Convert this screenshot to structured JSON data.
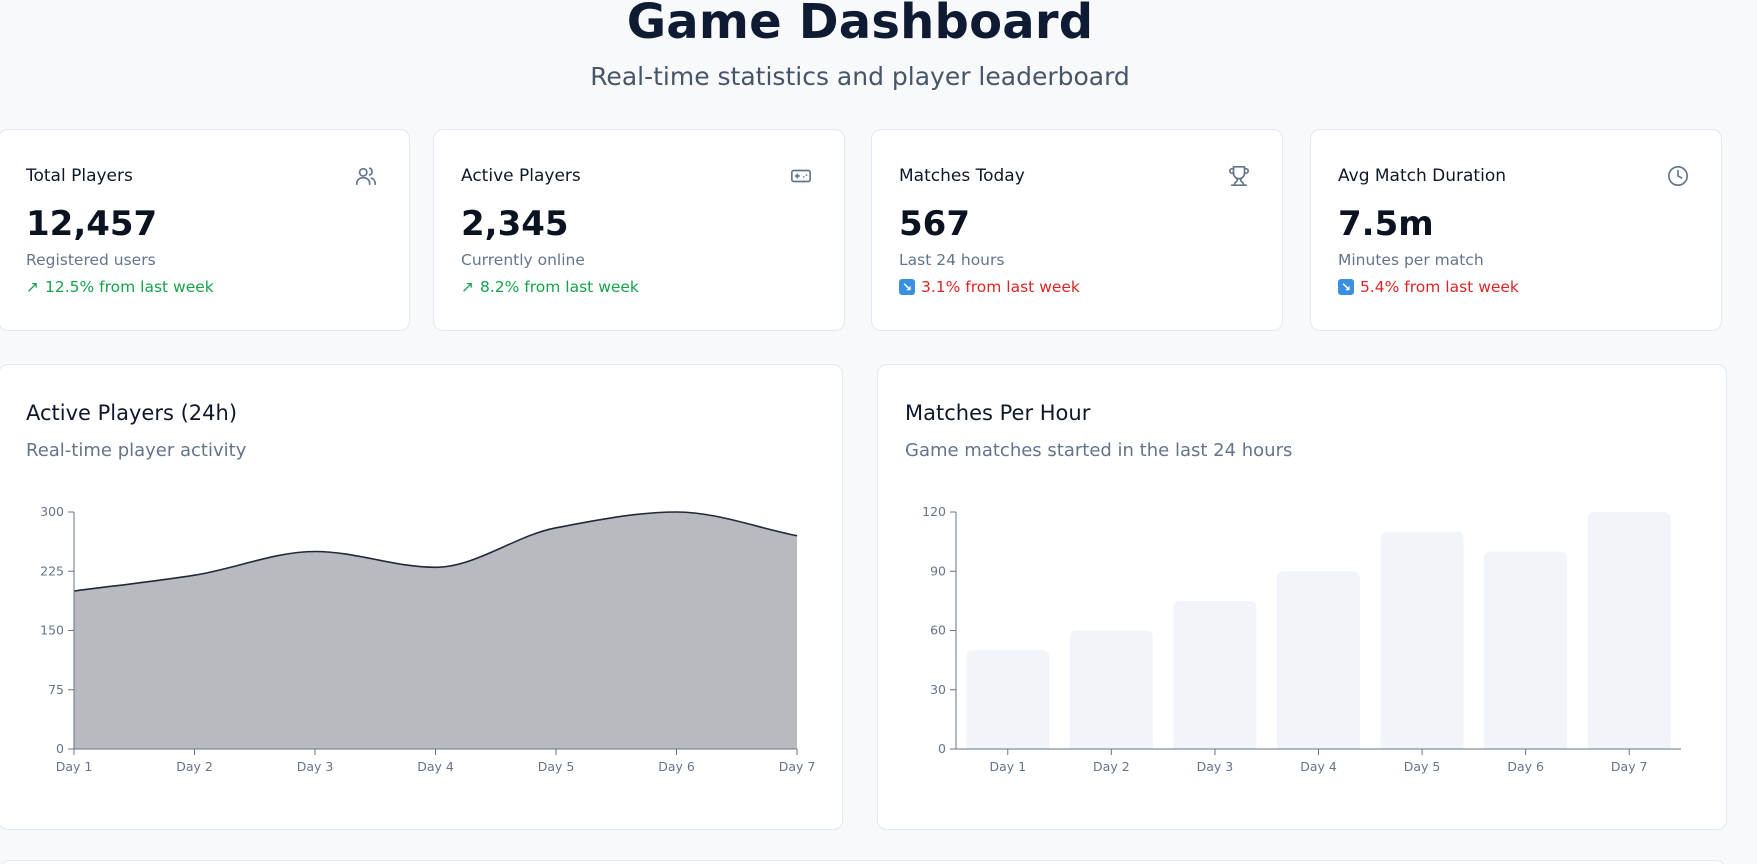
{
  "header": {
    "title": "Game Dashboard",
    "subtitle": "Real-time statistics and player leaderboard"
  },
  "stats": [
    {
      "title": "Total Players",
      "value": "12,457",
      "desc": "Registered users",
      "trend": "12.5% from last week",
      "trend_dir": "up",
      "trend_arrow": "↗",
      "icon": "users-icon"
    },
    {
      "title": "Active Players",
      "value": "2,345",
      "desc": "Currently online",
      "trend": "8.2% from last week",
      "trend_dir": "up",
      "trend_arrow": "↗",
      "icon": "gamepad-icon"
    },
    {
      "title": "Matches Today",
      "value": "567",
      "desc": "Last 24 hours",
      "trend": "3.1% from last week",
      "trend_dir": "down",
      "trend_arrow": "↘",
      "icon": "trophy-icon"
    },
    {
      "title": "Avg Match Duration",
      "value": "7.5m",
      "desc": "Minutes per match",
      "trend": "5.4% from last week",
      "trend_dir": "down",
      "trend_arrow": "↘",
      "icon": "clock-icon"
    }
  ],
  "colors": {
    "up": "#16a34a",
    "down": "#dc2626",
    "area_fill": "#b8babf",
    "area_stroke": "#1e293b",
    "bar_fill": "#f1f4f8",
    "axis": "#64748b"
  },
  "charts": {
    "active_players": {
      "title": "Active Players (24h)",
      "subtitle": "Real-time player activity"
    },
    "matches_per_hour": {
      "title": "Matches Per Hour",
      "subtitle": "Game matches started in the last 24 hours"
    }
  },
  "chart_data": [
    {
      "type": "area",
      "title": "Active Players (24h)",
      "categories": [
        "Day 1",
        "Day 2",
        "Day 3",
        "Day 4",
        "Day 5",
        "Day 6",
        "Day 7"
      ],
      "values": [
        200,
        220,
        250,
        230,
        280,
        300,
        270
      ],
      "ylim": [
        0,
        300
      ],
      "yticks": [
        0,
        75,
        150,
        225,
        300
      ],
      "grid": false
    },
    {
      "type": "bar",
      "title": "Matches Per Hour",
      "categories": [
        "Day 1",
        "Day 2",
        "Day 3",
        "Day 4",
        "Day 5",
        "Day 6",
        "Day 7"
      ],
      "values": [
        50,
        60,
        75,
        90,
        110,
        100,
        120
      ],
      "ylim": [
        0,
        120
      ],
      "yticks": [
        0,
        30,
        60,
        90,
        120
      ],
      "grid": false
    }
  ]
}
